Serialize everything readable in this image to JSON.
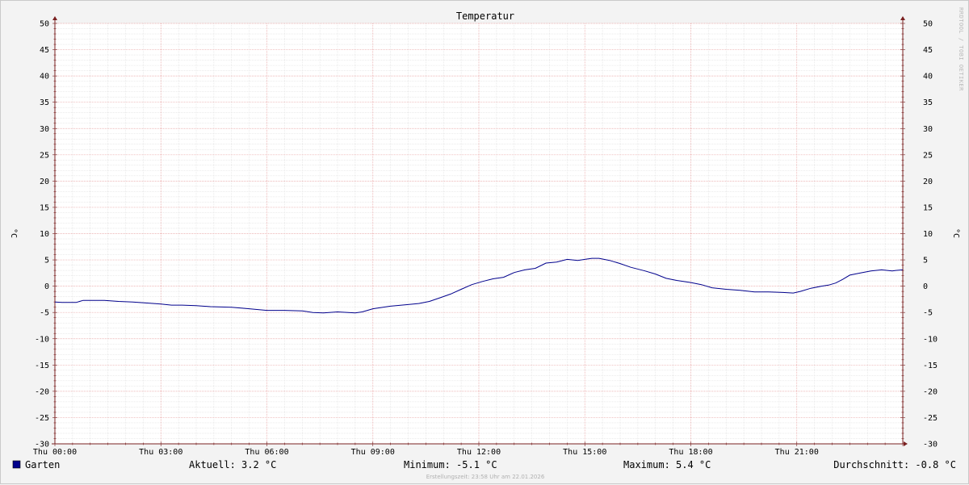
{
  "chart_data": {
    "type": "line",
    "title": "Temperatur",
    "ylabel": "°C",
    "ylim": [
      -30,
      50
    ],
    "y_ticks": [
      50,
      45,
      40,
      35,
      30,
      25,
      20,
      15,
      10,
      5,
      0,
      -5,
      -10,
      -15,
      -20,
      -25,
      -30
    ],
    "x_range_hours": [
      0,
      24
    ],
    "x_ticks": [
      {
        "hour": 0,
        "label": "Thu 00:00"
      },
      {
        "hour": 3,
        "label": "Thu 03:00"
      },
      {
        "hour": 6,
        "label": "Thu 06:00"
      },
      {
        "hour": 9,
        "label": "Thu 09:00"
      },
      {
        "hour": 12,
        "label": "Thu 12:00"
      },
      {
        "hour": 15,
        "label": "Thu 15:00"
      },
      {
        "hour": 18,
        "label": "Thu 18:00"
      },
      {
        "hour": 21,
        "label": "Thu 21:00"
      }
    ],
    "grid": true,
    "series": [
      {
        "name": "Garten",
        "color": "#00008c",
        "points": [
          [
            0.0,
            -3.0
          ],
          [
            0.2,
            -3.1
          ],
          [
            0.4,
            -3.1
          ],
          [
            0.6,
            -3.1
          ],
          [
            0.7,
            -2.9
          ],
          [
            0.8,
            -2.7
          ],
          [
            1.0,
            -2.7
          ],
          [
            1.4,
            -2.7
          ],
          [
            1.8,
            -2.9
          ],
          [
            2.2,
            -3.0
          ],
          [
            2.6,
            -3.2
          ],
          [
            3.0,
            -3.4
          ],
          [
            3.3,
            -3.6
          ],
          [
            3.6,
            -3.6
          ],
          [
            4.0,
            -3.7
          ],
          [
            4.4,
            -3.9
          ],
          [
            5.0,
            -4.0
          ],
          [
            5.5,
            -4.3
          ],
          [
            6.0,
            -4.6
          ],
          [
            6.5,
            -4.6
          ],
          [
            7.0,
            -4.7
          ],
          [
            7.3,
            -5.0
          ],
          [
            7.6,
            -5.1
          ],
          [
            8.0,
            -4.9
          ],
          [
            8.5,
            -5.1
          ],
          [
            8.7,
            -4.9
          ],
          [
            9.0,
            -4.3
          ],
          [
            9.5,
            -3.8
          ],
          [
            10.0,
            -3.5
          ],
          [
            10.3,
            -3.3
          ],
          [
            10.6,
            -2.9
          ],
          [
            10.9,
            -2.2
          ],
          [
            11.2,
            -1.5
          ],
          [
            11.5,
            -0.6
          ],
          [
            11.8,
            0.3
          ],
          [
            12.1,
            0.9
          ],
          [
            12.4,
            1.4
          ],
          [
            12.7,
            1.7
          ],
          [
            13.0,
            2.6
          ],
          [
            13.3,
            3.1
          ],
          [
            13.6,
            3.4
          ],
          [
            13.9,
            4.4
          ],
          [
            14.2,
            4.6
          ],
          [
            14.5,
            5.1
          ],
          [
            14.8,
            4.9
          ],
          [
            15.0,
            5.1
          ],
          [
            15.2,
            5.3
          ],
          [
            15.4,
            5.3
          ],
          [
            15.7,
            4.9
          ],
          [
            16.0,
            4.3
          ],
          [
            16.3,
            3.6
          ],
          [
            16.7,
            2.9
          ],
          [
            17.0,
            2.3
          ],
          [
            17.3,
            1.5
          ],
          [
            17.6,
            1.1
          ],
          [
            18.0,
            0.7
          ],
          [
            18.3,
            0.3
          ],
          [
            18.6,
            -0.3
          ],
          [
            19.0,
            -0.6
          ],
          [
            19.4,
            -0.8
          ],
          [
            19.8,
            -1.1
          ],
          [
            20.2,
            -1.1
          ],
          [
            20.6,
            -1.2
          ],
          [
            20.9,
            -1.3
          ],
          [
            21.1,
            -1.0
          ],
          [
            21.4,
            -0.4
          ],
          [
            21.7,
            0.0
          ],
          [
            21.9,
            0.2
          ],
          [
            22.1,
            0.6
          ],
          [
            22.3,
            1.3
          ],
          [
            22.5,
            2.1
          ],
          [
            22.8,
            2.5
          ],
          [
            23.1,
            2.9
          ],
          [
            23.4,
            3.1
          ],
          [
            23.7,
            2.9
          ],
          [
            23.8,
            3.0
          ],
          [
            24.0,
            3.1
          ]
        ]
      }
    ],
    "legend": {
      "swatch_color": "#00008c",
      "name": "Garten",
      "aktuell": "Aktuell: 3.2 °C",
      "minimum": "Minimum: -5.1 °C",
      "maximum": "Maximum: 5.4 °C",
      "durchschnitt": "Durchschnitt: -0.8 °C"
    },
    "footer": "Erstellungszeit: 23:58 Uhr am 22.01.2026",
    "watermark": "RRDTOOL / TOBI OETIKER"
  },
  "colors": {
    "background": "#f3f3f3",
    "plot_background": "#ffffff",
    "major_grid": "#e8a0a0",
    "minor_grid": "#d8d8d8",
    "axis": "#7a2020",
    "line": "#00008c"
  }
}
